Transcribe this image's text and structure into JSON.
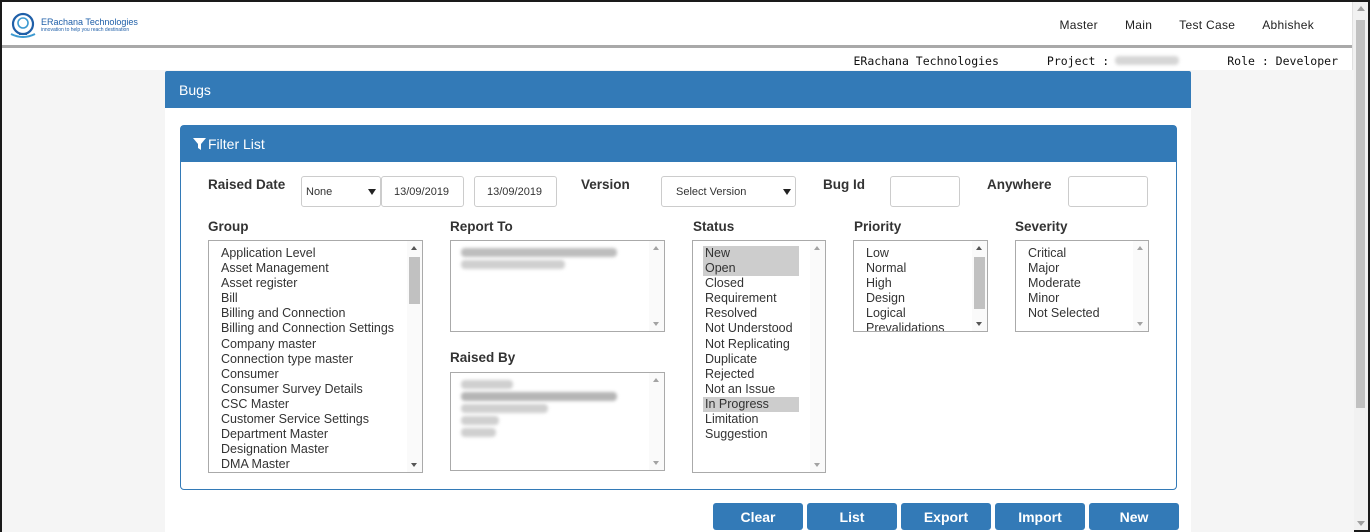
{
  "app": {
    "brand_name": "ERachana Technologies",
    "brand_tagline": "innovation to help you reach destination"
  },
  "topnav": [
    "Master",
    "Main",
    "Test Case",
    "Abhishek"
  ],
  "infobar": {
    "company": "ERachana Technologies",
    "project_label": "Project :",
    "role": "Role : Developer"
  },
  "page": {
    "title": "Bugs"
  },
  "filter": {
    "title": "Filter List",
    "raised_date_label": "Raised Date",
    "date_option": "None",
    "date_from": "13/09/2019",
    "date_to": "13/09/2019",
    "version_label": "Version",
    "version_value": "Select Version",
    "bug_id_label": "Bug Id",
    "anywhere_label": "Anywhere",
    "group_label": "Group",
    "report_to_label": "Report To",
    "raised_by_label": "Raised By",
    "status_label": "Status",
    "priority_label": "Priority",
    "severity_label": "Severity"
  },
  "group_items": [
    "Application Level",
    "Asset Management",
    "Asset register",
    "Bill",
    "Billing and Connection",
    "Billing and Connection Settings",
    "Company master",
    "Connection type master",
    "Consumer",
    "Consumer Survey Details",
    "CSC Master",
    "Customer Service Settings",
    "Department Master",
    "Designation Master",
    "DMA Master"
  ],
  "status_items": [
    "New",
    "Open",
    "Closed",
    "Requirement",
    "Resolved",
    "Not Understood",
    "Not Replicating",
    "Duplicate",
    "Rejected",
    "Not an Issue",
    "In Progress",
    "Limitation",
    "Suggestion"
  ],
  "priority_items": [
    "Low",
    "Normal",
    "High",
    "Design",
    "Logical",
    "Prevalidations"
  ],
  "severity_items": [
    "Critical",
    "Major",
    "Moderate",
    "Minor",
    "Not Selected"
  ],
  "buttons": {
    "clear": "Clear",
    "list": "List",
    "export": "Export",
    "import": "Import",
    "new": "New"
  },
  "colors": {
    "primary": "#337ab7",
    "selected_item": "#cdcdcd"
  },
  "icons": {
    "filter": "funnel-icon",
    "logo": "bulb-logo-icon"
  }
}
